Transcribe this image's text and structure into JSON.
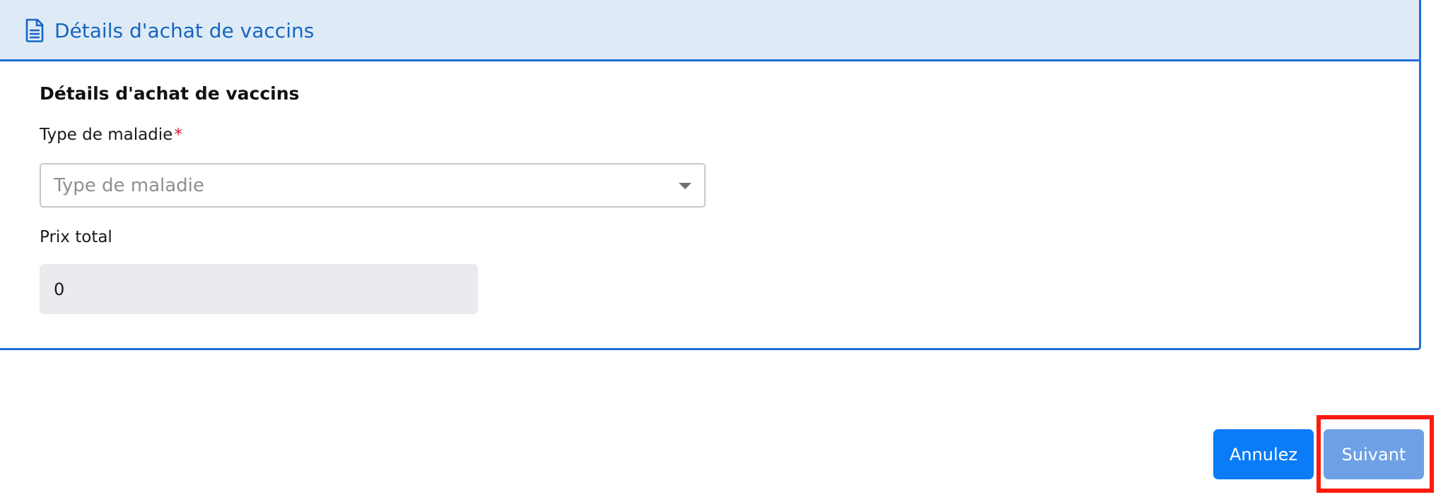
{
  "header": {
    "title": "Détails d'achat de vaccins",
    "icon": "document-icon",
    "accent_color": "#1f6ed4",
    "background_color": "#deebf7"
  },
  "form": {
    "section_title": "Détails d'achat de vaccins",
    "disease_type": {
      "label": "Type de maladie",
      "required_marker": "*",
      "placeholder": "Type de maladie",
      "value": ""
    },
    "total_price": {
      "label": "Prix total",
      "value": "0"
    }
  },
  "actions": {
    "cancel_label": "Annulez",
    "next_label": "Suivant",
    "cancel_color": "#0a7cf7",
    "next_color": "#6ea0e6",
    "highlight_color": "#ff1a0e"
  }
}
